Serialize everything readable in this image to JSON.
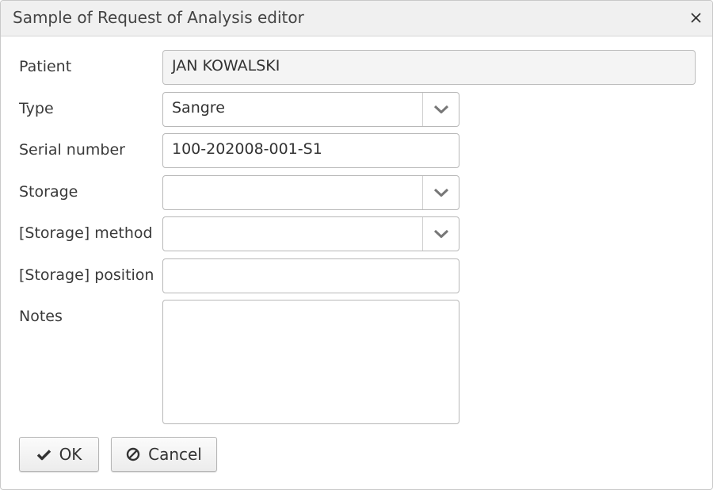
{
  "dialog": {
    "title": "Sample of Request of Analysis editor",
    "close_icon": "close-icon"
  },
  "form": {
    "patient": {
      "label": "Patient",
      "value": "JAN KOWALSKI"
    },
    "type": {
      "label": "Type",
      "value": "Sangre",
      "icon": "chevron-down-icon"
    },
    "serial_number": {
      "label": "Serial number",
      "value": "100-202008-001-S1"
    },
    "storage": {
      "label": "Storage",
      "value": "",
      "icon": "chevron-down-icon"
    },
    "storage_method": {
      "label": "[Storage] method",
      "value": "",
      "icon": "chevron-down-icon"
    },
    "storage_position": {
      "label": "[Storage] position",
      "value": ""
    },
    "notes": {
      "label": "Notes",
      "value": ""
    }
  },
  "buttons": {
    "ok": {
      "label": "OK",
      "icon": "checkmark-icon"
    },
    "cancel": {
      "label": "Cancel",
      "icon": "ban-icon"
    }
  },
  "colors": {
    "titlebar_bg": "#f0f0f0",
    "border": "#b8b8b8",
    "readonly_bg": "#f4f4f4"
  }
}
